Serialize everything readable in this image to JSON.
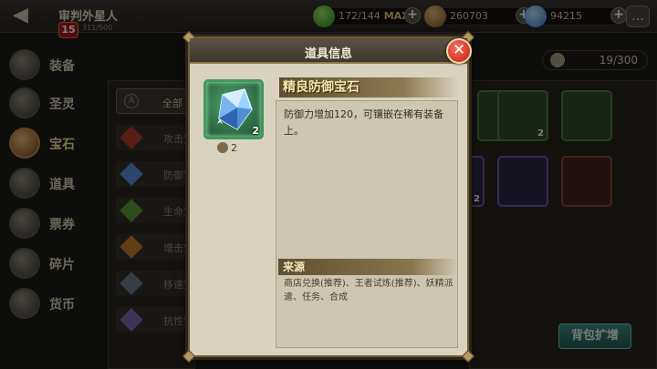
{
  "topbar": {
    "back_icon": "back-arrow-icon",
    "player_name": "审判外星人",
    "player_level": "15",
    "player_exp": "311/500",
    "energy": "172/144",
    "energy_max": "MAX",
    "gold": "260703",
    "gems": "94215",
    "chat_icon": "chat-bubble-icon"
  },
  "sidebar": {
    "items": [
      {
        "label": "装备",
        "icon": "armor-icon"
      },
      {
        "label": "圣灵",
        "icon": "spirit-icon"
      },
      {
        "label": "宝石",
        "icon": "gem-icon"
      },
      {
        "label": "道具",
        "icon": "potion-icon"
      },
      {
        "label": "票券",
        "icon": "ticket-icon"
      },
      {
        "label": "碎片",
        "icon": "shard-icon"
      },
      {
        "label": "货币",
        "icon": "currency-icon"
      }
    ],
    "active_index": 2
  },
  "filters": [
    {
      "label": "全部",
      "badge": "A"
    },
    {
      "label": "攻击宝",
      "color": "#b23a2e"
    },
    {
      "label": "防御宝",
      "color": "#5b8fd8"
    },
    {
      "label": "生命宝",
      "color": "#5a9a3a"
    },
    {
      "label": "增击宝",
      "color": "#c47a2c"
    },
    {
      "label": "移速宝",
      "color": "#6a7a8a"
    },
    {
      "label": "抗性宝",
      "color": "#7a6ab0"
    }
  ],
  "bag": {
    "capacity": "19/300",
    "expand_label": "背包扩增",
    "cells": [
      {
        "style": "green",
        "count": ""
      },
      {
        "style": "green",
        "count": "2"
      },
      {
        "style": "green",
        "count": ""
      },
      {
        "style": "purple",
        "count": "2"
      },
      {
        "style": "purple",
        "count": ""
      },
      {
        "style": "red",
        "count": ""
      }
    ]
  },
  "modal": {
    "title": "道具信息",
    "close_icon": "close-x-icon",
    "item_icon": "blue-crystal-gem-icon",
    "item_count": "2",
    "owned_qty": "2",
    "item_name": "精良防御宝石",
    "description": "防御力增加120，可镶嵌在稀有装备上。",
    "source_title": "来源",
    "source_text": "商店兑换(推荐)、王者试炼(推荐)、妖精派遣、任务、合成"
  }
}
